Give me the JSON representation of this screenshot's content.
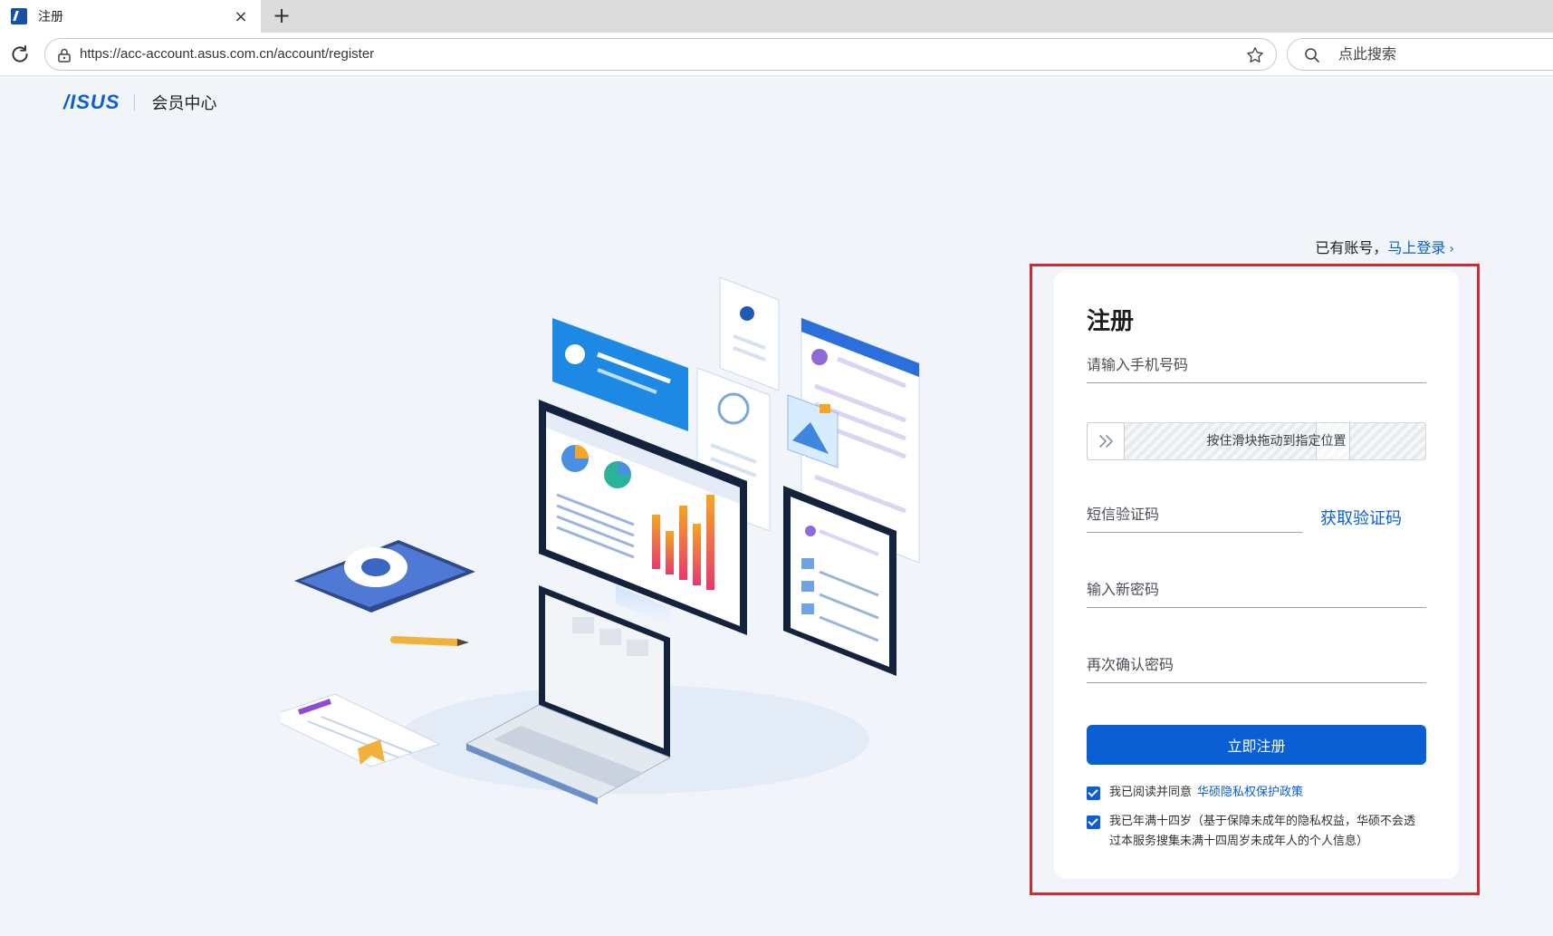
{
  "browser": {
    "tab_title": "注册",
    "tab_close": "×",
    "new_tab": "+",
    "url": "https://acc-account.asus.com.cn/account/register",
    "search_placeholder": "点此搜索"
  },
  "header": {
    "logo_text": "/ISUS",
    "brand_text": "会员中心"
  },
  "login": {
    "prompt": "已有账号，",
    "link": "马上登录",
    "chevron": "›"
  },
  "form": {
    "title": "注册",
    "phone_placeholder": "请输入手机号码",
    "slider_text": "按住滑块拖动到指定位置",
    "slider_handle": "»",
    "sms_placeholder": "短信验证码",
    "get_code": "获取验证码",
    "new_password_placeholder": "输入新密码",
    "confirm_password_placeholder": "再次确认密码",
    "submit": "立即注册",
    "agree_text": "我已阅读并同意",
    "policy_link": "华硕隐私权保护政策",
    "age_text": "我已年满十四岁（基于保障未成年的隐私权益，华硕不会透过本服务搜集未满十四周岁未成年人的个人信息）"
  },
  "colors": {
    "accent": "#0a5fd3",
    "page_bg": "#f1f5fa",
    "highlight": "#e0242e"
  }
}
